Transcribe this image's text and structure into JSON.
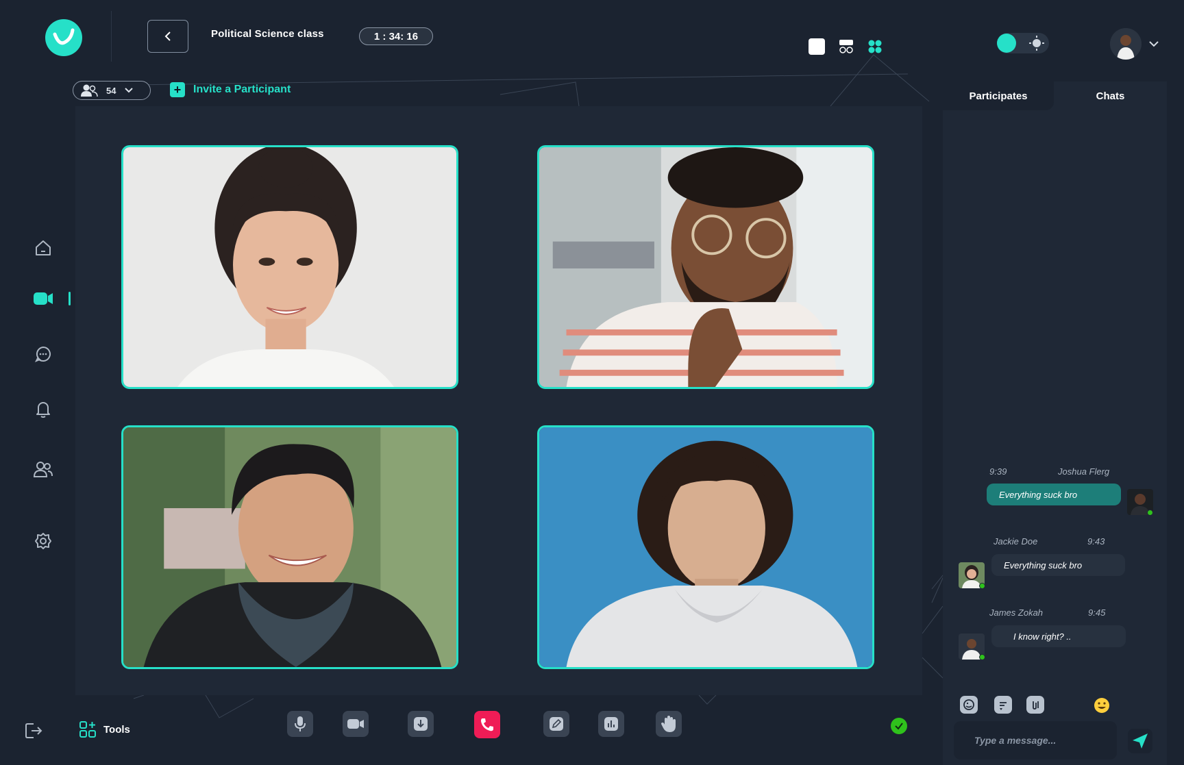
{
  "header": {
    "title": "Political  Science class",
    "timer": "1 : 34: 16"
  },
  "participants_bar": {
    "count": "54",
    "invite_label": "Invite a Participant"
  },
  "tabs": [
    {
      "label": "Participates",
      "active": true
    },
    {
      "label": "Chats",
      "active": false
    }
  ],
  "chat": {
    "messages": [
      {
        "time": "9:39",
        "name": "Joshua Flerg",
        "text": "Everything suck bro",
        "mine": true
      },
      {
        "name": "Jackie Doe",
        "time": "9:43",
        "text": "Everything suck bro",
        "mine": false
      },
      {
        "name": "James Zokah",
        "time": "9:45",
        "text": "I know right? ..",
        "mine": false
      }
    ],
    "input_placeholder": "Type a message..."
  },
  "footer": {
    "tools_label": "Tools"
  },
  "colors": {
    "accent": "#26e0c8",
    "background": "#1b2330",
    "panel": "#1f2836",
    "end_call": "#ef1c56",
    "online": "#2fc21c"
  },
  "sidebar": {
    "items": [
      "home-icon",
      "video-icon",
      "chat-icon",
      "bell-icon",
      "users-icon",
      "settings-icon",
      "logout-icon"
    ]
  }
}
